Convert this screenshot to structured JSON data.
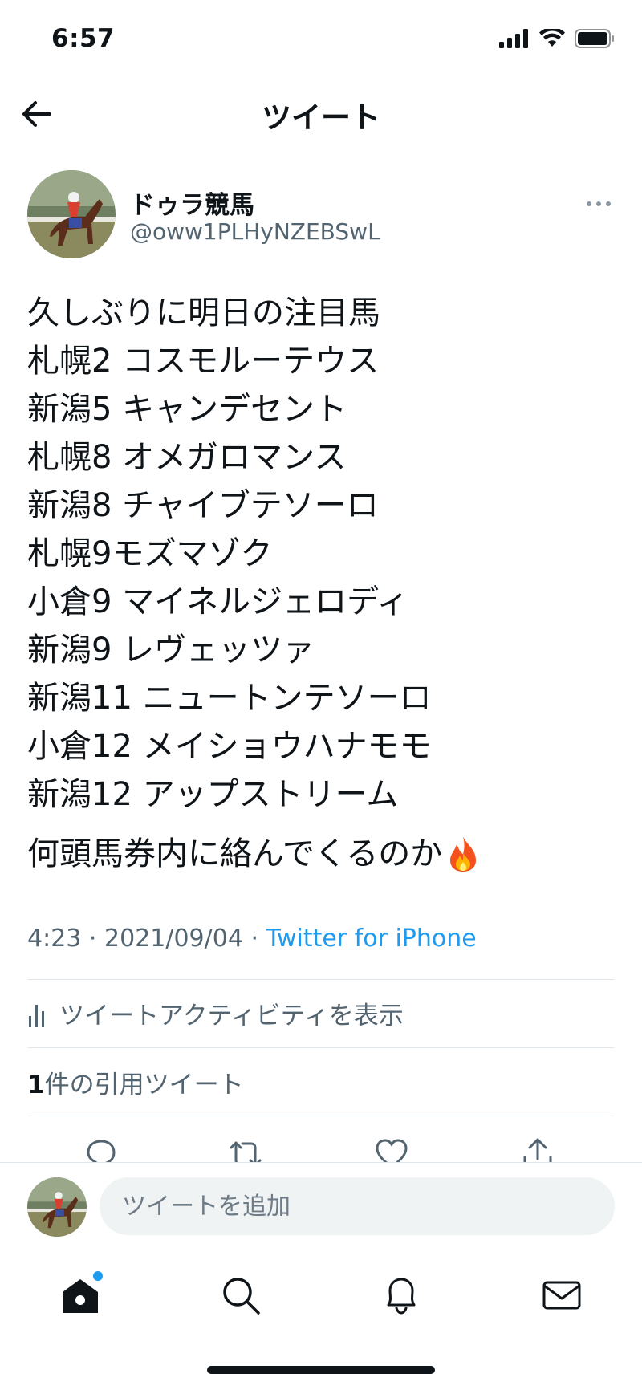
{
  "status_bar": {
    "time": "6:57"
  },
  "header": {
    "title": "ツイート"
  },
  "tweet": {
    "author_name": "ドゥラ競馬",
    "author_handle": "@oww1PLHyNZEBSwL",
    "lines": [
      "久しぶりに明日の注目馬",
      "札幌2 コスモルーテウス",
      "新潟5 キャンデセント",
      "札幌8 オメガロマンス",
      "新潟8 チャイブテソーロ",
      "札幌9モズマゾク",
      "小倉9 マイネルジェロディ",
      "新潟9 レヴェッツァ",
      "新潟11 ニュートンテソーロ",
      "小倉12 メイショウハナモモ",
      "新潟12 アップストリーム"
    ],
    "closing": "何頭馬券内に絡んでくるのか",
    "time": "4:23",
    "date": "2021/09/04",
    "separator": "·",
    "source": "Twitter for iPhone"
  },
  "activity": {
    "label": "ツイートアクティビティを表示"
  },
  "quotes": {
    "count": "1",
    "label": "件の引用ツイート"
  },
  "reply": {
    "placeholder": "ツイートを追加"
  },
  "icons": {
    "back": "arrow-left-icon",
    "more": "more-horizontal-icon",
    "activity": "bar-chart-icon",
    "reply": "comment-icon",
    "retweet": "retweet-icon",
    "like": "heart-icon",
    "share": "share-icon",
    "home": "home-icon",
    "search": "search-icon",
    "notifications": "bell-icon",
    "messages": "envelope-icon",
    "fire": "fire-emoji-icon"
  },
  "colors": {
    "accent": "#1d9bf0",
    "text": "#0f1419",
    "secondary": "#536471"
  }
}
